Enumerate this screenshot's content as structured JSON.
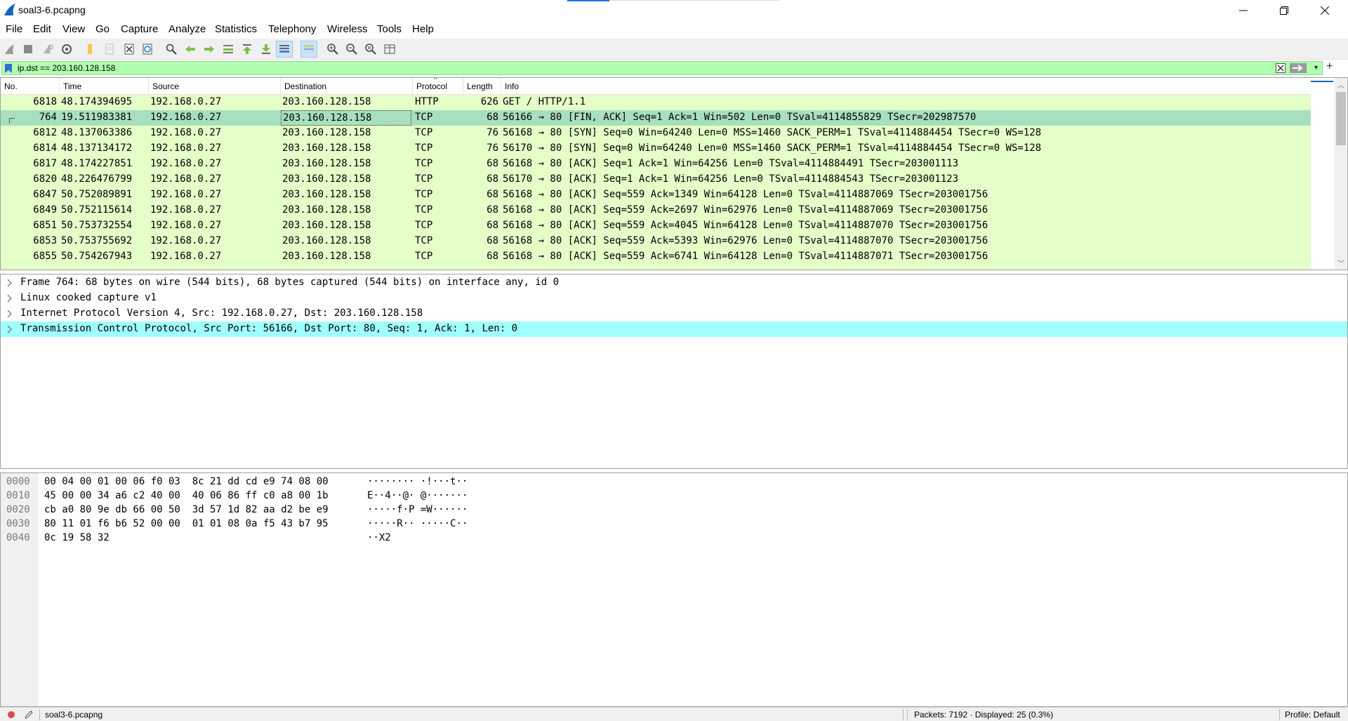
{
  "window": {
    "title": "soal3-6.pcapng"
  },
  "menu": [
    "File",
    "Edit",
    "View",
    "Go",
    "Capture",
    "Analyze",
    "Statistics",
    "Telephony",
    "Wireless",
    "Tools",
    "Help"
  ],
  "toolbar_icons": [
    "shark-fin-icon",
    "stop-icon",
    "restart-icon",
    "options-gear-icon",
    "open-folder-icon",
    "file-icon",
    "close-file-icon",
    "reload-icon",
    "find-icon",
    "back-arrow-icon",
    "forward-arrow-icon",
    "jump-icon",
    "first-packet-icon",
    "last-packet-icon",
    "autoscroll-icon",
    "colorize-icon",
    "zoom-in-icon",
    "zoom-out-icon",
    "normal-size-icon",
    "resize-columns-icon"
  ],
  "filter": {
    "value": "ip.dst == 203.160.128.158",
    "background": "#afffaf"
  },
  "packet_list": {
    "columns": [
      "No.",
      "Time",
      "Source",
      "Destination",
      "Protocol",
      "Length",
      "Info"
    ],
    "rows": [
      {
        "no": "6818",
        "time": "48.174394695",
        "src": "192.168.0.27",
        "dst": "203.160.128.158",
        "proto": "HTTP",
        "len": "626",
        "info": "GET / HTTP/1.1"
      },
      {
        "no": "764",
        "time": "19.511983381",
        "src": "192.168.0.27",
        "dst": "203.160.128.158",
        "proto": "TCP",
        "len": "68",
        "info": "56166 → 80 [FIN, ACK] Seq=1 Ack=1 Win=502 Len=0 TSval=4114855829 TSecr=202987570"
      },
      {
        "no": "6812",
        "time": "48.137063386",
        "src": "192.168.0.27",
        "dst": "203.160.128.158",
        "proto": "TCP",
        "len": "76",
        "info": "56168 → 80 [SYN] Seq=0 Win=64240 Len=0 MSS=1460 SACK_PERM=1 TSval=4114884454 TSecr=0 WS=128"
      },
      {
        "no": "6814",
        "time": "48.137134172",
        "src": "192.168.0.27",
        "dst": "203.160.128.158",
        "proto": "TCP",
        "len": "76",
        "info": "56170 → 80 [SYN] Seq=0 Win=64240 Len=0 MSS=1460 SACK_PERM=1 TSval=4114884454 TSecr=0 WS=128"
      },
      {
        "no": "6817",
        "time": "48.174227851",
        "src": "192.168.0.27",
        "dst": "203.160.128.158",
        "proto": "TCP",
        "len": "68",
        "info": "56168 → 80 [ACK] Seq=1 Ack=1 Win=64256 Len=0 TSval=4114884491 TSecr=203001113"
      },
      {
        "no": "6820",
        "time": "48.226476799",
        "src": "192.168.0.27",
        "dst": "203.160.128.158",
        "proto": "TCP",
        "len": "68",
        "info": "56170 → 80 [ACK] Seq=1 Ack=1 Win=64256 Len=0 TSval=4114884543 TSecr=203001123"
      },
      {
        "no": "6847",
        "time": "50.752089891",
        "src": "192.168.0.27",
        "dst": "203.160.128.158",
        "proto": "TCP",
        "len": "68",
        "info": "56168 → 80 [ACK] Seq=559 Ack=1349 Win=64128 Len=0 TSval=4114887069 TSecr=203001756"
      },
      {
        "no": "6849",
        "time": "50.752115614",
        "src": "192.168.0.27",
        "dst": "203.160.128.158",
        "proto": "TCP",
        "len": "68",
        "info": "56168 → 80 [ACK] Seq=559 Ack=2697 Win=62976 Len=0 TSval=4114887069 TSecr=203001756"
      },
      {
        "no": "6851",
        "time": "50.753732554",
        "src": "192.168.0.27",
        "dst": "203.160.128.158",
        "proto": "TCP",
        "len": "68",
        "info": "56168 → 80 [ACK] Seq=559 Ack=4045 Win=64128 Len=0 TSval=4114887070 TSecr=203001756"
      },
      {
        "no": "6853",
        "time": "50.753755692",
        "src": "192.168.0.27",
        "dst": "203.160.128.158",
        "proto": "TCP",
        "len": "68",
        "info": "56168 → 80 [ACK] Seq=559 Ack=5393 Win=62976 Len=0 TSval=4114887070 TSecr=203001756"
      },
      {
        "no": "6855",
        "time": "50.754267943",
        "src": "192.168.0.27",
        "dst": "203.160.128.158",
        "proto": "TCP",
        "len": "68",
        "info": "56168 → 80 [ACK] Seq=559 Ack=6741 Win=64128 Len=0 TSval=4114887071 TSecr=203001756"
      }
    ],
    "selected_index": 1,
    "row_color": "#e4ffc7",
    "selected_color": "#a8dfc0"
  },
  "details": {
    "lines": [
      "Frame 764: 68 bytes on wire (544 bits), 68 bytes captured (544 bits) on interface any, id 0",
      "Linux cooked capture v1",
      "Internet Protocol Version 4, Src: 192.168.0.27, Dst: 203.160.128.158",
      "Transmission Control Protocol, Src Port: 56166, Dst Port: 80, Seq: 1, Ack: 1, Len: 0"
    ],
    "selected_index": 3,
    "selected_color": "#a0ffff"
  },
  "bytes": {
    "rows": [
      {
        "offset": "0000",
        "hex": "00 04 00 01 00 06 f0 03  8c 21 dd cd e9 74 08 00",
        "ascii": "········ ·!···t··"
      },
      {
        "offset": "0010",
        "hex": "45 00 00 34 a6 c2 40 00  40 06 86 ff c0 a8 00 1b",
        "ascii": "E··4··@· @·······"
      },
      {
        "offset": "0020",
        "hex": "cb a0 80 9e db 66 00 50  3d 57 1d 82 aa d2 be e9",
        "ascii": "·····f·P =W······"
      },
      {
        "offset": "0030",
        "hex": "80 11 01 f6 b6 52 00 00  01 01 08 0a f5 43 b7 95",
        "ascii": "·····R·· ·····C··"
      },
      {
        "offset": "0040",
        "hex": "0c 19 58 32",
        "ascii": "··X2"
      }
    ]
  },
  "status": {
    "file": "soal3-6.pcapng",
    "packets": "Packets: 7192 · Displayed: 25 (0.3%)",
    "profile": "Profile: Default"
  }
}
